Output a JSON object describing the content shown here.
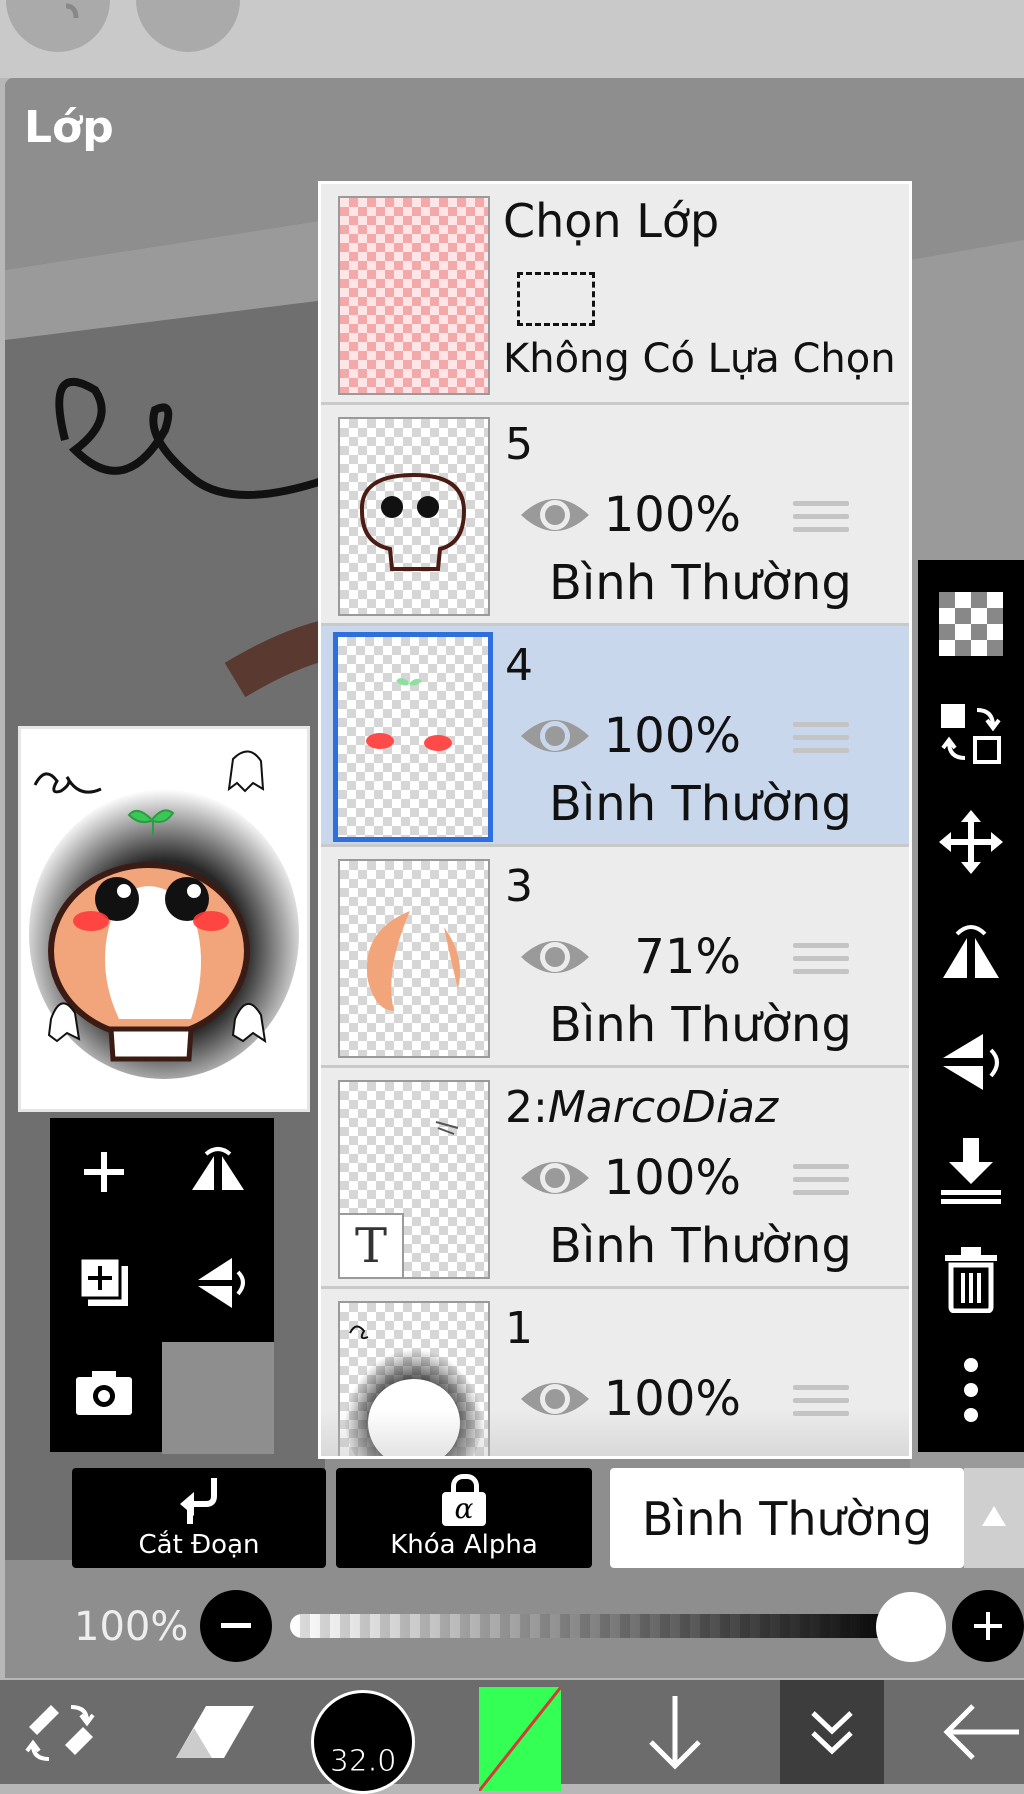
{
  "dialog": {
    "title": "Lớp"
  },
  "selection_layer": {
    "title": "Chọn Lớp",
    "status": "Không Có Lựa Chọn"
  },
  "layers": [
    {
      "number": "5",
      "opacity": "100%",
      "blend": "Bình Thường",
      "selected": false
    },
    {
      "number": "4",
      "opacity": "100%",
      "blend": "Bình Thường",
      "selected": true
    },
    {
      "number": "3",
      "opacity": "71%",
      "blend": "Bình Thường",
      "selected": false
    },
    {
      "number": "2:",
      "name": "MarcoDiaz",
      "opacity": "100%",
      "blend": "Bình Thường",
      "selected": false
    },
    {
      "number": "1",
      "opacity": "100%",
      "blend": "",
      "selected": false
    }
  ],
  "layer2_thumb_glyph": "T",
  "bottom_buttons": {
    "clip": "Cắt Đoạn",
    "alpha_lock": "Khóa Alpha",
    "alpha_glyph": "α"
  },
  "blend_select": {
    "value": "Bình Thường"
  },
  "opacity_slider": {
    "label": "100%",
    "value": 1.0
  },
  "brush_size": "32.0",
  "colors": {
    "accent_selected": "#2f6fdc",
    "selected_row": "#c9d7ec",
    "current_color": "#33ff55"
  },
  "icons": [
    "undo-icon",
    "checker-icon",
    "swap-layers-icon",
    "move-icon",
    "flip-horizontal-icon",
    "flip-vertical-icon",
    "merge-down-icon",
    "trash-icon",
    "more-icon",
    "add-layer-icon",
    "add-copy-icon",
    "camera-icon",
    "brush-swap-icon",
    "eraser-icon",
    "arrow-down-icon",
    "double-chevron-icon",
    "back-arrow-icon",
    "minus-icon",
    "plus-icon"
  ]
}
